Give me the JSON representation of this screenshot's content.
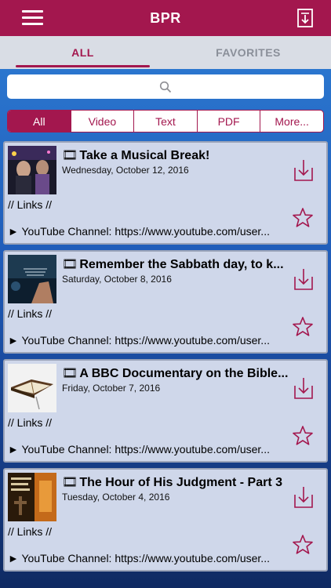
{
  "header": {
    "title": "BPR",
    "menu_icon": "hamburger-menu-icon",
    "download_icon": "download-list-icon",
    "bg_color": "#a3174e"
  },
  "tabs": [
    {
      "label": "ALL",
      "active": true
    },
    {
      "label": "FAVORITES",
      "active": false
    }
  ],
  "search": {
    "icon": "search-icon",
    "placeholder": ""
  },
  "filters": [
    {
      "label": "All",
      "active": true
    },
    {
      "label": "Video",
      "active": false
    },
    {
      "label": "Text",
      "active": false
    },
    {
      "label": "PDF",
      "active": false
    },
    {
      "label": "More...",
      "active": false
    }
  ],
  "posts": [
    {
      "title": "Take a Musical Break!",
      "date": "Wednesday, October 12, 2016",
      "links": "// Links //",
      "youtube": "► YouTube Channel: https://www.youtube.com/user..."
    },
    {
      "title": "Remember the Sabbath day, to k...",
      "date": "Saturday, October 8, 2016",
      "links": "// Links //",
      "youtube": "► YouTube Channel: https://www.youtube.com/user..."
    },
    {
      "title": "A BBC Documentary on the Bible...",
      "date": "Friday, October 7, 2016",
      "links": "// Links //",
      "youtube": "► YouTube Channel: https://www.youtube.com/user..."
    },
    {
      "title": "The Hour of His Judgment - Part 3",
      "date": "Tuesday, October 4, 2016",
      "links": "// Links //",
      "youtube": "► YouTube Channel: https://www.youtube.com/user..."
    }
  ],
  "colors": {
    "accent": "#a3174e",
    "card_bg": "#cfd7ea",
    "tab_bar_bg": "#d9dde5"
  }
}
